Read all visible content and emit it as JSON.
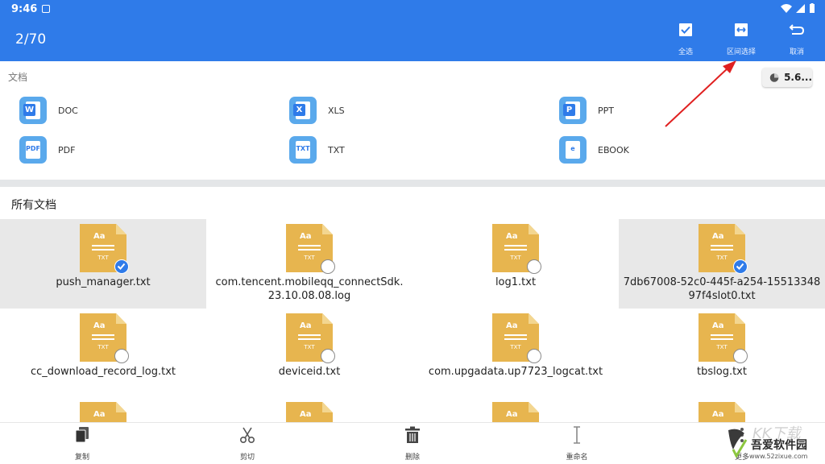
{
  "status_bar": {
    "time": "9:46"
  },
  "app_bar": {
    "selection_count": "2/70",
    "actions": [
      {
        "label": "全选",
        "icon": "select-all-icon"
      },
      {
        "label": "区间选择",
        "icon": "range-select-icon"
      },
      {
        "label": "取消",
        "icon": "undo-icon"
      }
    ]
  },
  "documents_section": {
    "label": "文档",
    "storage": "5.6...",
    "categories": [
      {
        "label": "DOC",
        "icon": "word-doc-icon"
      },
      {
        "label": "XLS",
        "icon": "excel-xls-icon"
      },
      {
        "label": "PPT",
        "icon": "powerpoint-ppt-icon"
      },
      {
        "label": "PDF",
        "icon": "pdf-file-icon"
      },
      {
        "label": "TXT",
        "icon": "txt-file-icon"
      },
      {
        "label": "EBOOK",
        "icon": "ebook-file-icon"
      }
    ]
  },
  "all_documents": {
    "label": "所有文档",
    "file_icon_text": "Aa",
    "file_icon_ext": "TXT",
    "files": [
      {
        "name_line1": "push_manager.txt",
        "name_line2": "",
        "selected": true
      },
      {
        "name_line1": "com.tencent.mobileqq_connectSdk.",
        "name_line2": "23.10.08.08.log",
        "selected": false
      },
      {
        "name_line1": "log1.txt",
        "name_line2": "",
        "selected": false
      },
      {
        "name_line1": "7db67008-52c0-445f-a254-15513348",
        "name_line2": "97f4slot0.txt",
        "selected": true
      },
      {
        "name_line1": "cc_download_record_log.txt",
        "name_line2": "",
        "selected": false
      },
      {
        "name_line1": "deviceid.txt",
        "name_line2": "",
        "selected": false
      },
      {
        "name_line1": "com.upgadata.up7723_logcat.txt",
        "name_line2": "",
        "selected": false
      },
      {
        "name_line1": "tbslog.txt",
        "name_line2": "",
        "selected": false
      }
    ]
  },
  "bottom_bar": {
    "actions": [
      {
        "label": "复制",
        "icon": "copy-icon"
      },
      {
        "label": "剪切",
        "icon": "scissors-icon"
      },
      {
        "label": "删除",
        "icon": "trash-icon"
      },
      {
        "label": "重命名",
        "icon": "rename-cursor-icon"
      },
      {
        "label": "更多",
        "icon": "more-icon"
      }
    ]
  },
  "watermark": {
    "text": "吾爱软件园",
    "url": "www.52zixue.com",
    "faint": "KK下载"
  },
  "colors": {
    "primary": "#2f7be9",
    "file_icon": "#e7b54f",
    "category_icon": "#5aa9ec",
    "annotation": "#e02020",
    "selected_row": "#e8e8e8"
  }
}
